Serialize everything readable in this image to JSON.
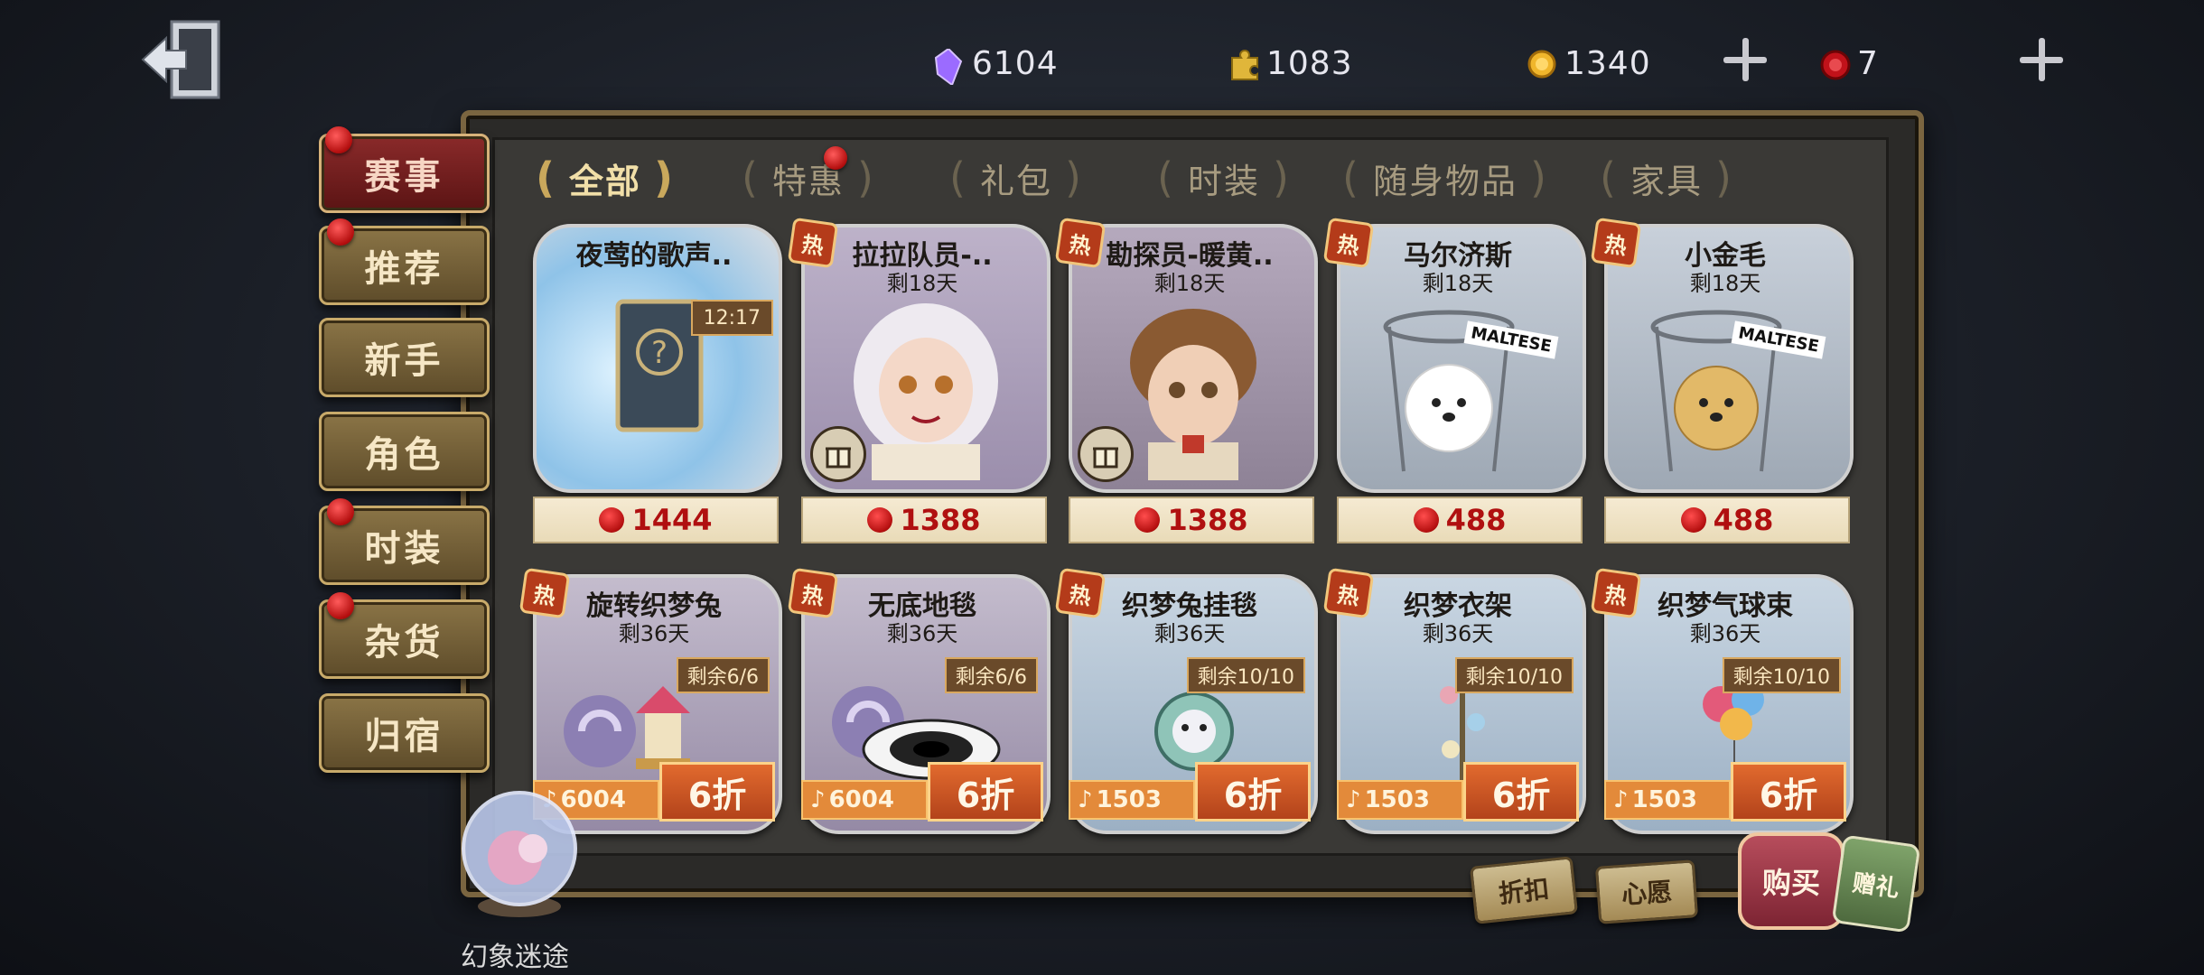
{
  "currency": {
    "gem": "6104",
    "puzzle": "1083",
    "coin": "1340",
    "seal": "7"
  },
  "side_menu": [
    {
      "label": "赛事",
      "active": true,
      "dot": true
    },
    {
      "label": "推荐",
      "active": false,
      "dot": true
    },
    {
      "label": "新手",
      "active": false,
      "dot": false
    },
    {
      "label": "角色",
      "active": false,
      "dot": false
    },
    {
      "label": "时装",
      "active": false,
      "dot": true
    },
    {
      "label": "杂货",
      "active": false,
      "dot": true
    },
    {
      "label": "归宿",
      "active": false,
      "dot": false
    }
  ],
  "tabs": [
    {
      "label": "全部",
      "active": true
    },
    {
      "label": "特惠",
      "active": false
    },
    {
      "label": "礼包",
      "active": false
    },
    {
      "label": "时装",
      "active": false
    },
    {
      "label": "随身物品",
      "active": false
    },
    {
      "label": "家具",
      "active": false
    }
  ],
  "cards_row1": [
    {
      "name": "夜莺的歌声..",
      "days": "",
      "timer": "12:17",
      "price": "1444",
      "hot": false,
      "hot_label": ""
    },
    {
      "name": "拉拉队员-..",
      "days": "剩18天",
      "price": "1388",
      "hot": true,
      "hot_label": "热",
      "gift": true
    },
    {
      "name": "勘探员-暖黄..",
      "days": "剩18天",
      "price": "1388",
      "hot": true,
      "hot_label": "热",
      "gift": true
    },
    {
      "name": "马尔济斯",
      "days": "剩18天",
      "price": "488",
      "hot": true,
      "hot_label": "热",
      "sign": "MALTESE"
    },
    {
      "name": "小金毛",
      "days": "剩18天",
      "price": "488",
      "hot": true,
      "hot_label": "热",
      "sign": "MALTESE"
    }
  ],
  "cards_row2": [
    {
      "name": "旋转织梦兔",
      "days": "剩36天",
      "stock": "剩余6/6",
      "note_price": "6004",
      "discount": "6折",
      "hot_label": "热"
    },
    {
      "name": "无底地毯",
      "days": "剩36天",
      "stock": "剩余6/6",
      "note_price": "6004",
      "discount": "6折",
      "hot_label": "热"
    },
    {
      "name": "织梦兔挂毯",
      "days": "剩36天",
      "stock": "剩余10/10",
      "note_price": "1503",
      "discount": "6折",
      "hot_label": "热"
    },
    {
      "name": "织梦衣架",
      "days": "剩36天",
      "stock": "剩余10/10",
      "note_price": "1503",
      "discount": "6折",
      "hot_label": "热"
    },
    {
      "name": "织梦气球束",
      "days": "剩36天",
      "stock": "剩余10/10",
      "note_price": "1503",
      "discount": "6折",
      "hot_label": "热"
    }
  ],
  "bottom": {
    "orb_label": "幻象迷途",
    "exchange_label": "折扣",
    "wish_label": "心愿",
    "buy_label": "购买",
    "gift_label": "赠礼"
  },
  "colors": {
    "accent_red": "#b01010",
    "gold": "#c9a85c",
    "discount_orange": "#e16a2e"
  }
}
